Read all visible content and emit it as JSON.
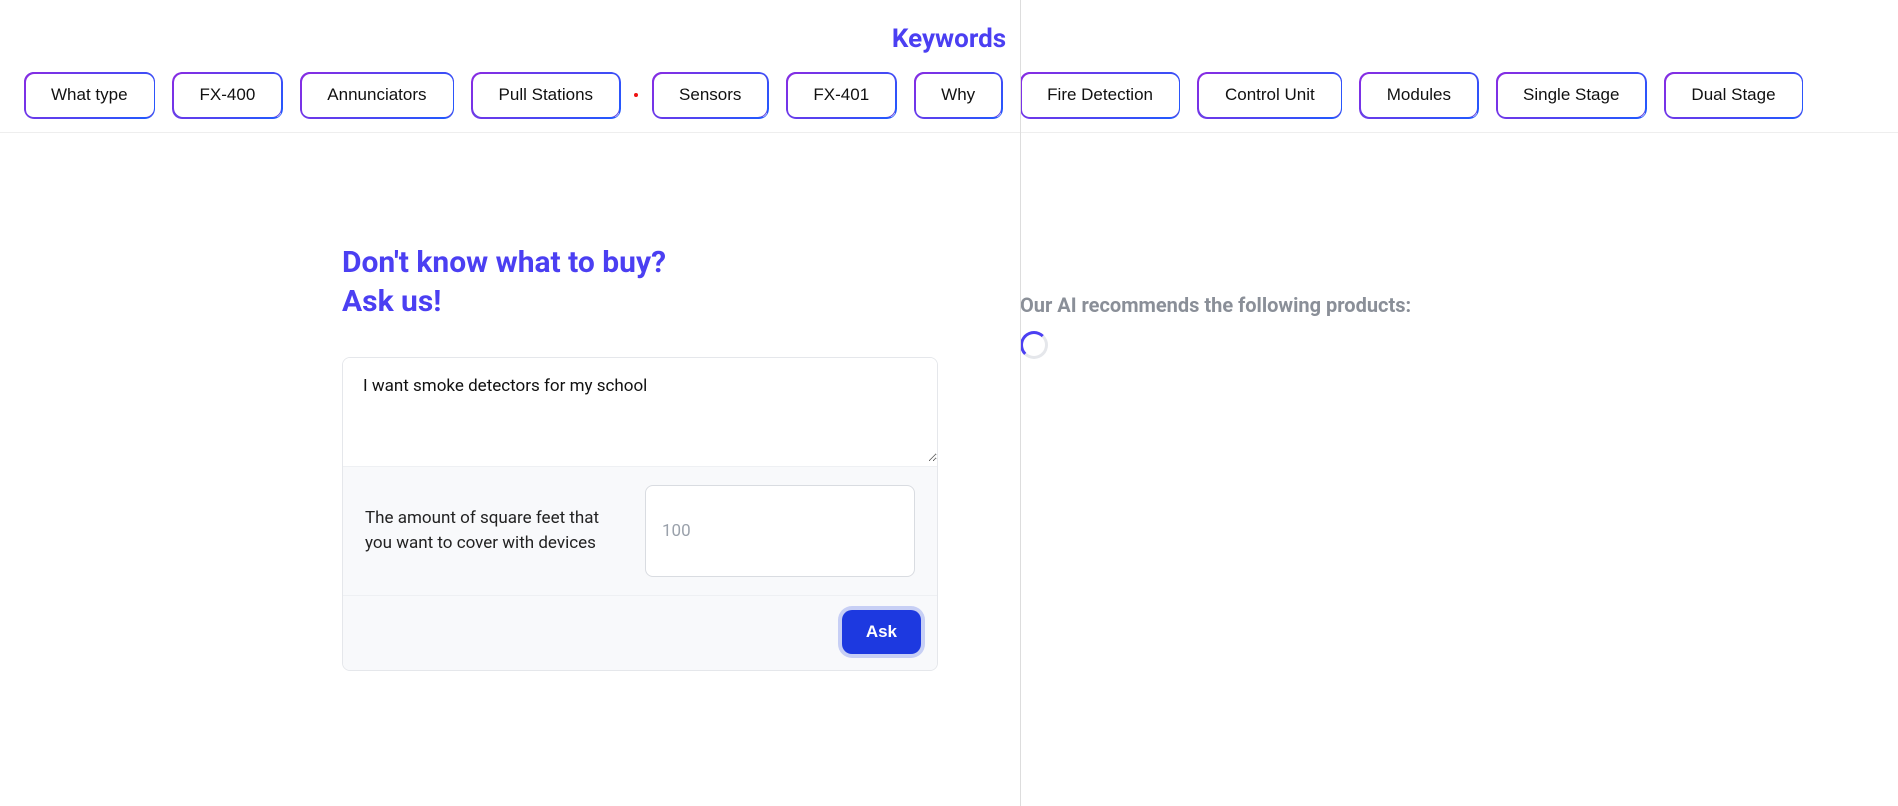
{
  "header": {
    "title": "Keywords"
  },
  "keywords": [
    "What type",
    "FX-400",
    "Annunciators",
    "Pull Stations",
    "Sensors",
    "FX-401",
    "Why",
    "Fire Detection",
    "Control Unit",
    "Modules",
    "Single Stage",
    "Dual Stage"
  ],
  "prompt": {
    "heading_line1": "Don't know what to buy?",
    "heading_line2": "Ask us!"
  },
  "form": {
    "query_value": "I want smoke detectors for my school",
    "sqft_label": "The amount of square feet that you want to cover with devices",
    "sqft_placeholder": "100",
    "ask_label": "Ask"
  },
  "results": {
    "heading": "Our AI recommends the following products:"
  }
}
